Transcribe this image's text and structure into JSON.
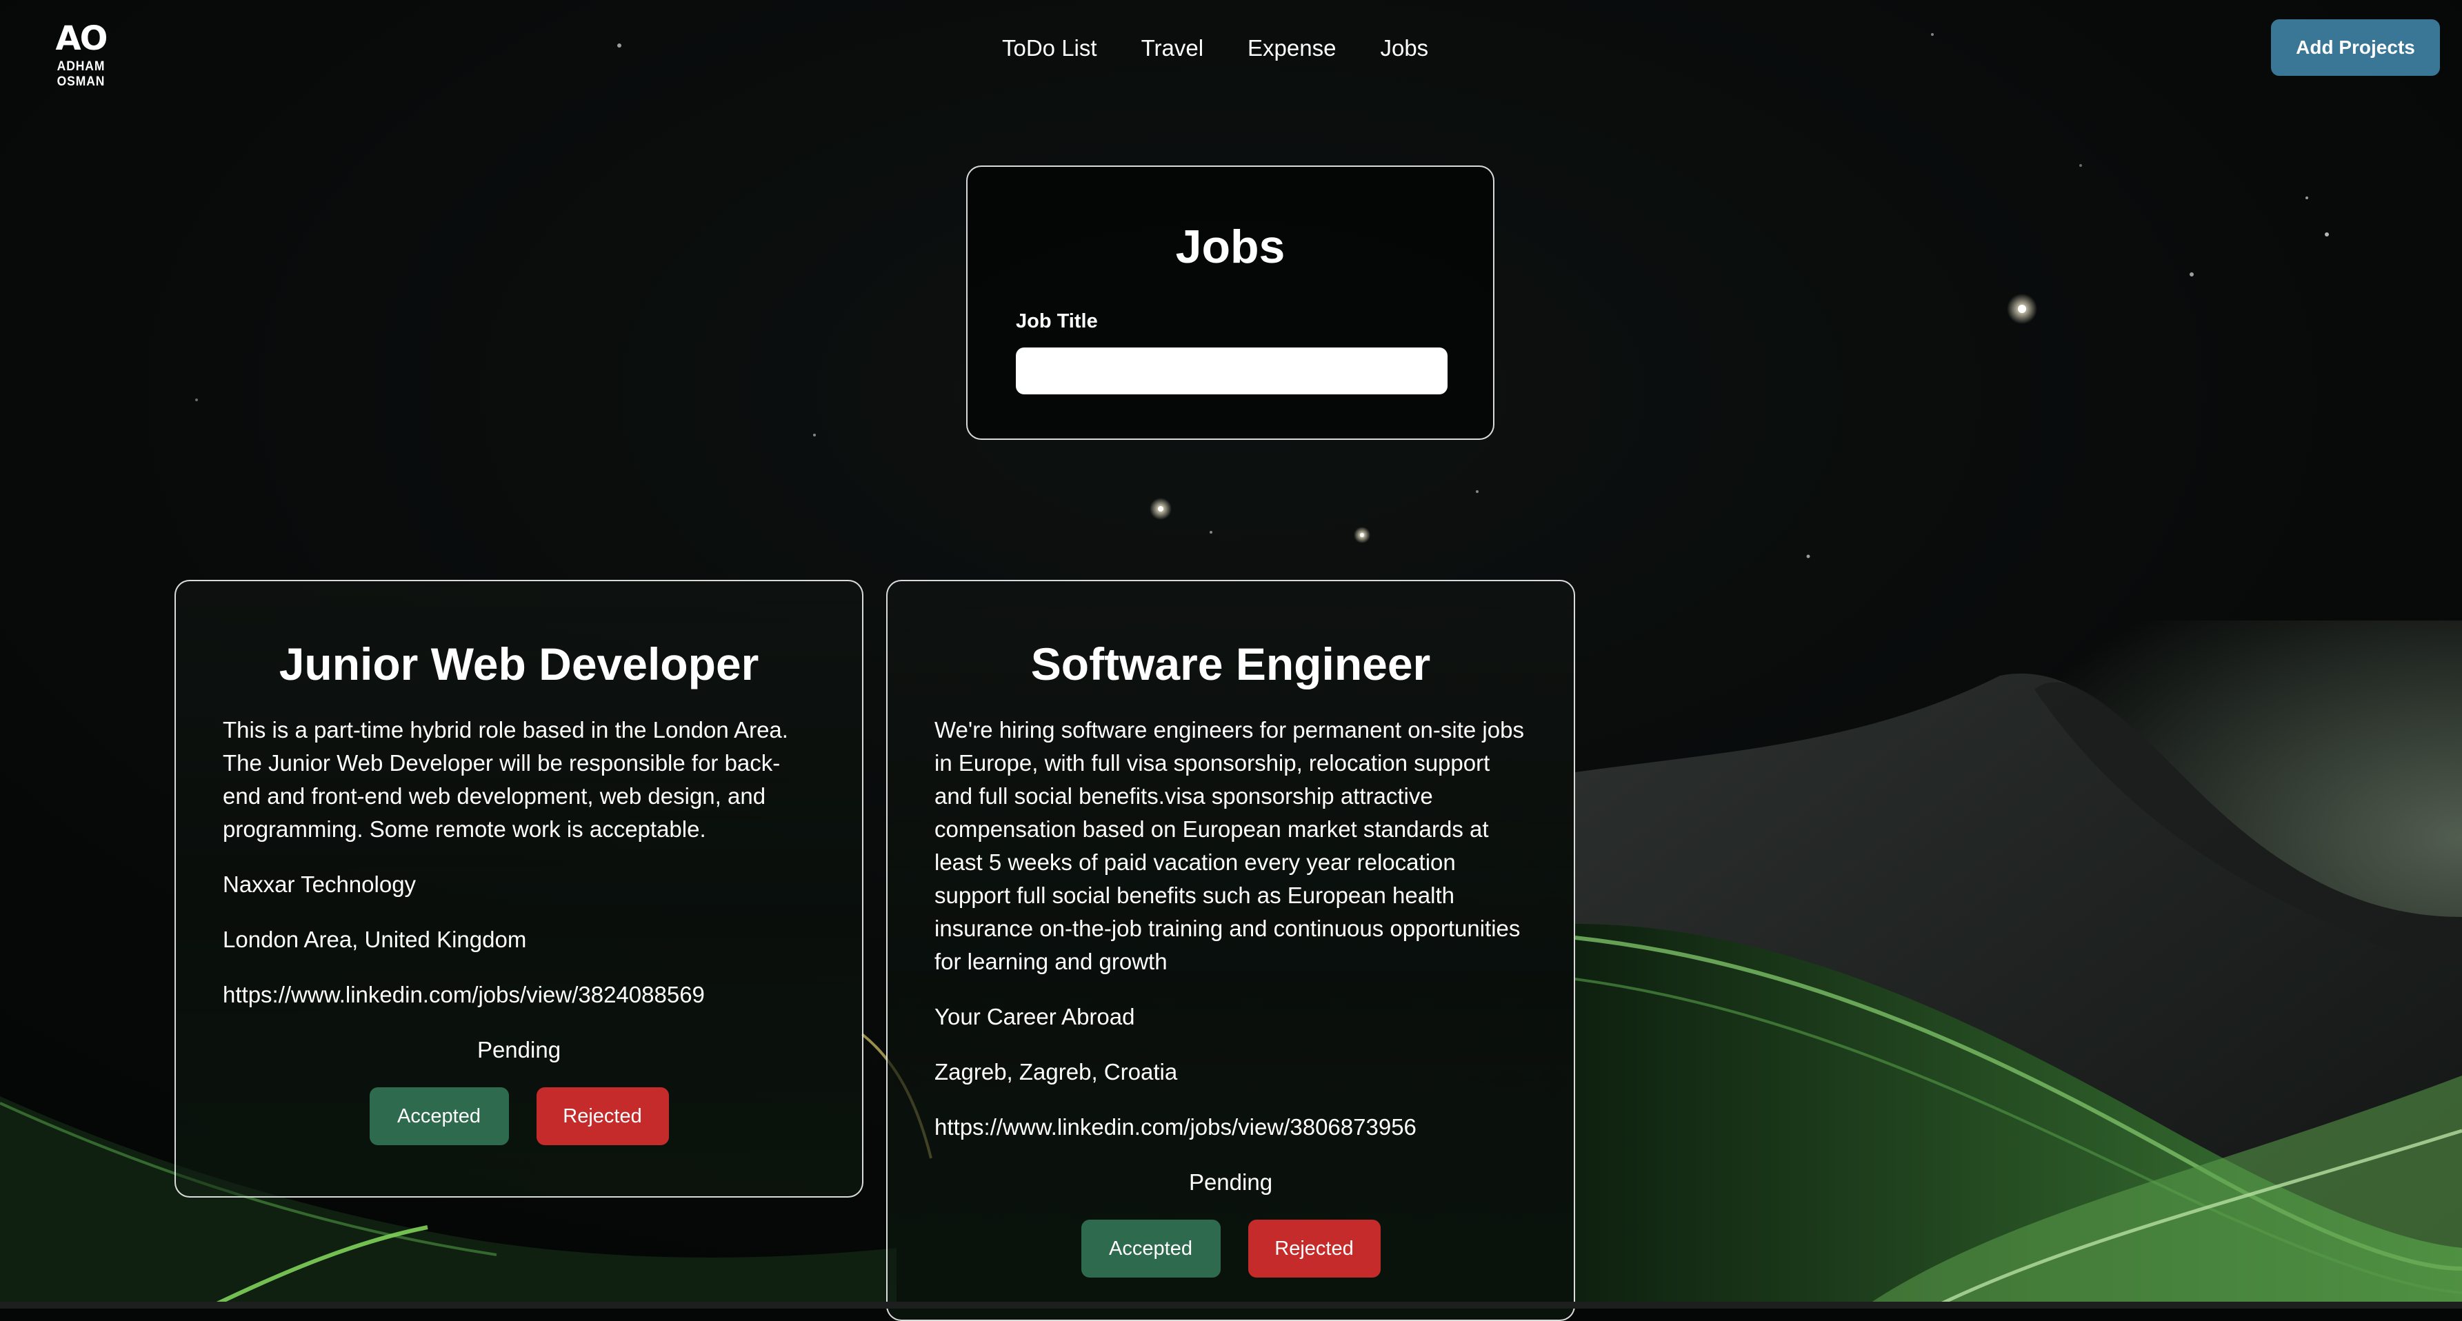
{
  "header": {
    "logo_mark": "AO",
    "logo_text": "ADHAM OSMAN",
    "nav": [
      "ToDo List",
      "Travel",
      "Expense",
      "Jobs"
    ],
    "add_projects_label": "Add Projects"
  },
  "search": {
    "title": "Jobs",
    "label": "Job Title",
    "value": ""
  },
  "jobs": [
    {
      "title": "Junior Web Developer",
      "description": "This is a part-time hybrid role based in the London Area. The Junior Web Developer will be responsible for back-end and front-end web development, web design, and programming. Some remote work is acceptable.",
      "company": "Naxxar Technology",
      "location": "London Area, United Kingdom",
      "url": "https://www.linkedin.com/jobs/view/3824088569",
      "status": "Pending",
      "accept_label": "Accepted",
      "reject_label": "Rejected"
    },
    {
      "title": "Software Engineer",
      "description": "We're hiring software engineers for permanent on-site jobs in Europe, with full visa sponsorship, relocation support and full social benefits.visa sponsorship attractive compensation based on European market standards at least 5 weeks of paid vacation every year relocation support full social benefits such as European health insurance on-the-job training and continuous opportunities for learning and growth",
      "company": "Your Career Abroad",
      "location": "Zagreb, Zagreb, Croatia",
      "url": "https://www.linkedin.com/jobs/view/3806873956",
      "status": "Pending",
      "accept_label": "Accepted",
      "reject_label": "Rejected"
    }
  ],
  "colors": {
    "add_button": "#3a7695",
    "accept_button": "#2e6a4e",
    "reject_button": "#c62b2b",
    "background": "#050706",
    "hills": "#3f8a3a"
  }
}
